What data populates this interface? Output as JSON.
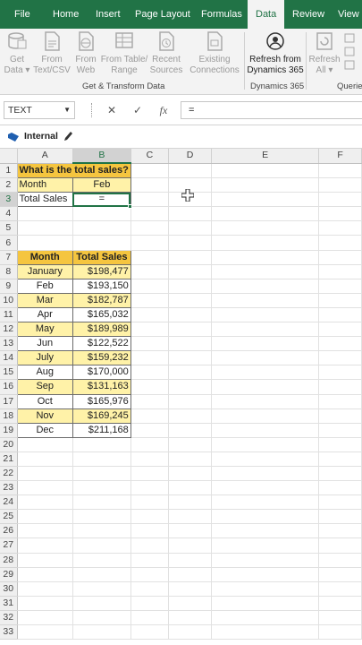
{
  "tabs": [
    "File",
    "Home",
    "Insert",
    "Page Layout",
    "Formulas",
    "Data",
    "Review",
    "View"
  ],
  "active_tab": "Data",
  "ribbon": {
    "get_data": [
      "Get",
      "Data"
    ],
    "from_text": [
      "From",
      "Text/CSV"
    ],
    "from_web": [
      "From",
      "Web"
    ],
    "from_table": [
      "From Table/",
      "Range"
    ],
    "recent_sources": [
      "Recent",
      "Sources"
    ],
    "existing_connections": [
      "Existing",
      "Connections"
    ],
    "refresh_dynamics": [
      "Refresh from",
      "Dynamics 365"
    ],
    "refresh_all": [
      "Refresh",
      "All"
    ],
    "group_get_transform": "Get & Transform Data",
    "group_dynamics": "Dynamics 365",
    "group_queries": "Querie"
  },
  "formula_bar": {
    "name_box": "TEXT",
    "formula": "="
  },
  "sensitivity": {
    "label": "Internal"
  },
  "columns": [
    "A",
    "B",
    "C",
    "D",
    "E",
    "F"
  ],
  "rows": [
    "1",
    "2",
    "3",
    "4",
    "5",
    "6",
    "7",
    "8",
    "9",
    "10",
    "11",
    "12",
    "13",
    "14",
    "15",
    "16",
    "17",
    "18",
    "19",
    "20",
    "21",
    "22",
    "23",
    "24",
    "25",
    "26",
    "27",
    "28",
    "29",
    "30",
    "31",
    "32",
    "33"
  ],
  "question": {
    "title": "What is the total sales?",
    "month_label": "Month",
    "month_value": "Feb",
    "total_label": "Total Sales",
    "total_value": "="
  },
  "sales_table": {
    "headers": [
      "Month",
      "Total Sales"
    ],
    "rows": [
      [
        "January",
        "$198,477"
      ],
      [
        "Feb",
        "$193,150"
      ],
      [
        "Mar",
        "$182,787"
      ],
      [
        "Apr",
        "$165,032"
      ],
      [
        "May",
        "$189,989"
      ],
      [
        "Jun",
        "$122,522"
      ],
      [
        "July",
        "$159,232"
      ],
      [
        "Aug",
        "$170,000"
      ],
      [
        "Sep",
        "$131,163"
      ],
      [
        "Oct",
        "$165,976"
      ],
      [
        "Nov",
        "$169,245"
      ],
      [
        "Dec",
        "$211,168"
      ]
    ]
  },
  "colors": {
    "excel_green": "#217346",
    "highlight_yellow": "#fff2a8",
    "header_gold": "#f5c53f"
  }
}
